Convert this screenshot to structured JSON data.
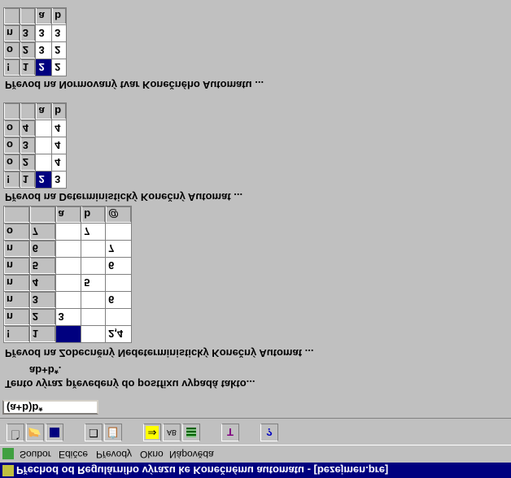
{
  "window": {
    "title": "Přechod od Regulárního výrazu ke Konečnému automatu - [bezejmen.pre]"
  },
  "menu": {
    "items": [
      "Soubor",
      "Edičce",
      "Převody",
      "Okno",
      "Nápověda"
    ]
  },
  "toolbar": {
    "buttons": [
      "new-icon",
      "open-icon",
      "save-icon",
      "copy-icon",
      "paste-icon",
      "arrow-right-icon",
      "convert-icon",
      "grid-icon",
      "tools-icon",
      "help-icon"
    ]
  },
  "input": {
    "expression": "(a+b)b*"
  },
  "labels": {
    "postfix_intro": "Tento výraz převedený do postfixu vypadá takto...",
    "postfix_value": "ab+b*.",
    "nka_title": "Převod na Zobecněný Nedeterministický Konečný Automat ...",
    "dka_title": "Převod na Deterministický Konečný Automat ...",
    "min_title": "Převod na Normovaný tvar Konečného Automatu ..."
  },
  "nka_table": {
    "headers": [
      "",
      "",
      "a",
      "b",
      "@"
    ],
    "rows": [
      [
        "!",
        "1",
        "",
        "",
        "2,4"
      ],
      [
        "n",
        "2",
        "3",
        "",
        ""
      ],
      [
        "n",
        "3",
        "",
        "",
        "6"
      ],
      [
        "n",
        "4",
        "",
        "5",
        ""
      ],
      [
        "n",
        "5",
        "",
        "",
        "6"
      ],
      [
        "n",
        "6",
        "",
        "",
        "7"
      ],
      [
        "o",
        "7",
        "",
        "7",
        ""
      ]
    ]
  },
  "dka_table": {
    "headers": [
      "",
      "",
      "a",
      "b"
    ],
    "rows": [
      [
        "!",
        "1",
        "2",
        "3"
      ],
      [
        "o",
        "2",
        "",
        "4"
      ],
      [
        "o",
        "3",
        "",
        "4"
      ],
      [
        "o",
        "4",
        "",
        "4"
      ]
    ]
  },
  "min_table": {
    "headers": [
      "",
      "",
      "a",
      "b"
    ],
    "rows": [
      [
        "!",
        "1",
        "2",
        "2"
      ],
      [
        "o",
        "2",
        "3",
        "2"
      ],
      [
        "n",
        "3",
        "3",
        "3"
      ]
    ]
  }
}
